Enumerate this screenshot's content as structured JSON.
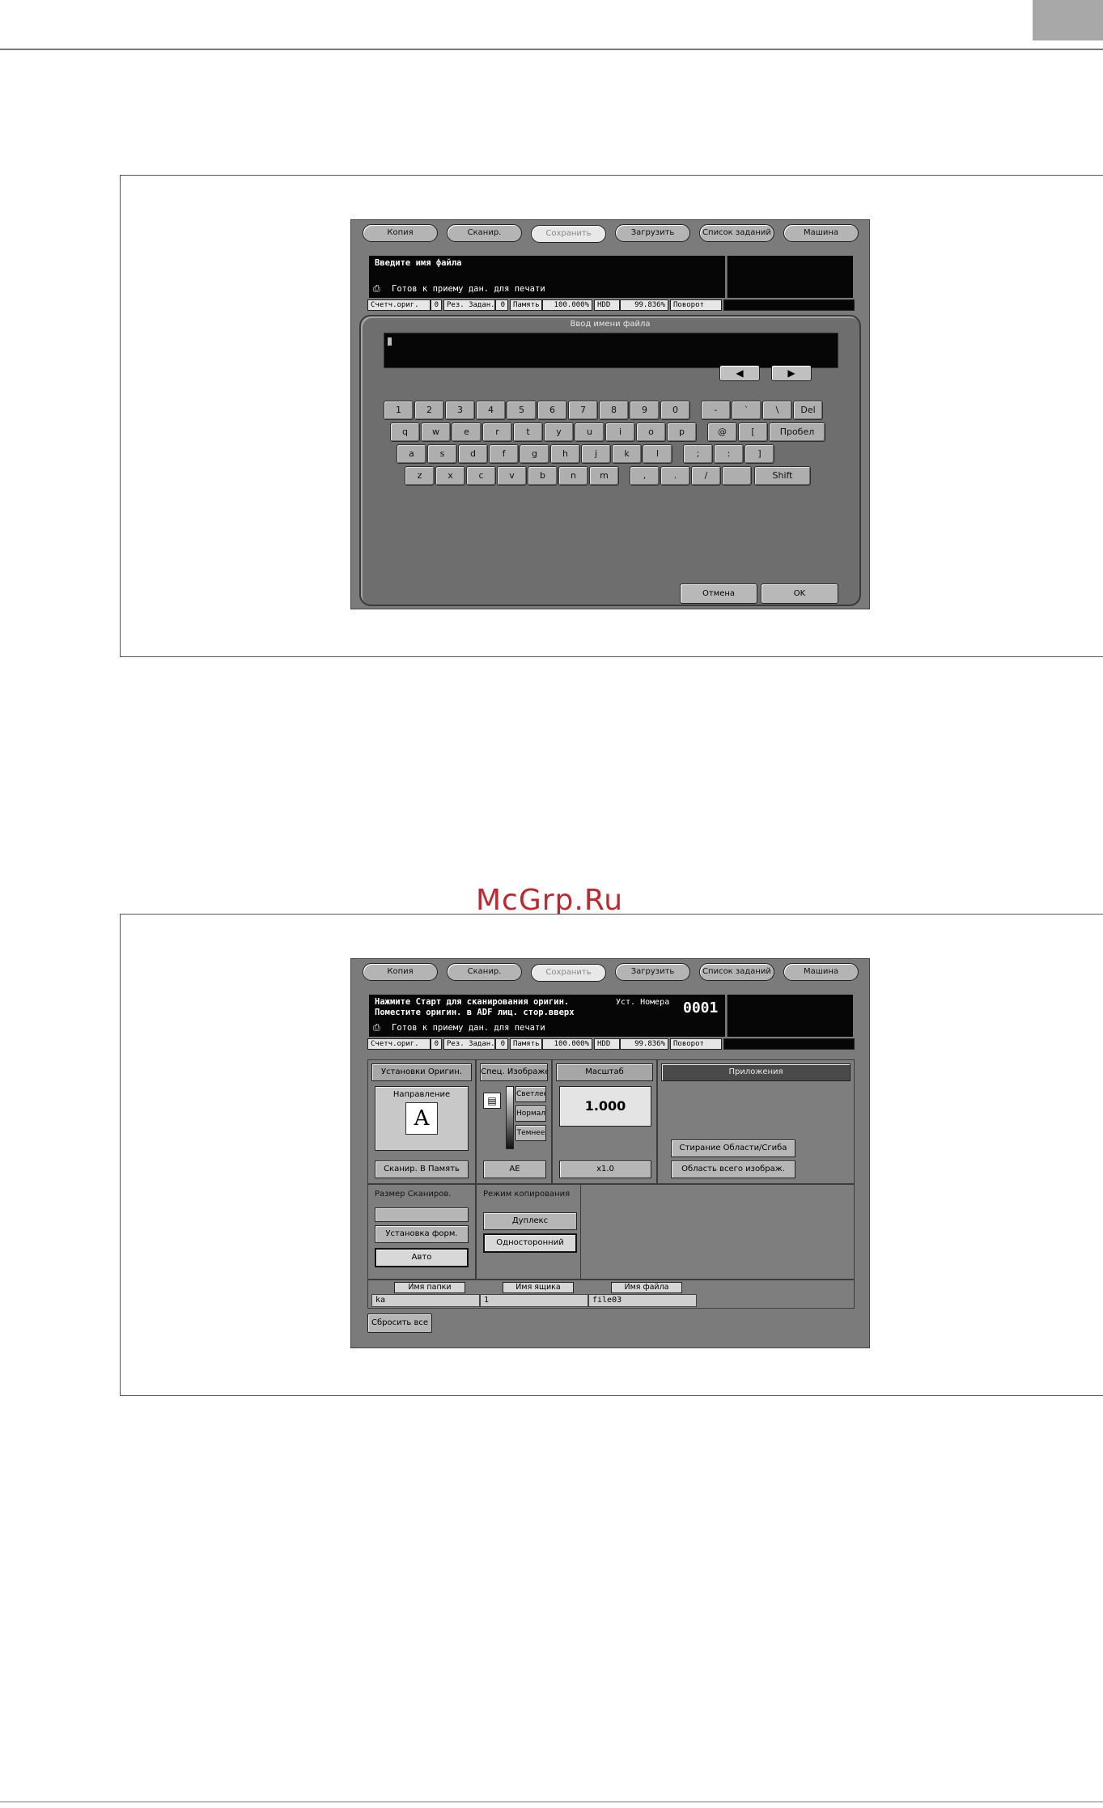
{
  "watermark": "McGrp.Ru",
  "tabs": [
    "Копия",
    "Сканир.",
    "Сохранить",
    "Загрузить",
    "Список заданий",
    "Машина"
  ],
  "counter": {
    "orig_label": "Счетч.ориг.",
    "orig_value": "0",
    "res_label": "Рез. Задан.",
    "res_value": "0",
    "mem_label": "Память",
    "mem_value": "100.000%",
    "hdd_label": "HDD",
    "hdd_value": "99.836%",
    "rotate_label": "Поворот"
  },
  "screen1": {
    "message": "Введите имя файла",
    "status": "Готов к приему дан. для печати",
    "dialog_title": "Ввод имени файла",
    "arrow_left": "◀",
    "arrow_right": "▶",
    "rows": [
      [
        "1",
        "2",
        "3",
        "4",
        "5",
        "6",
        "7",
        "8",
        "9",
        "0",
        "-",
        "`",
        "\\",
        "Del"
      ],
      [
        "q",
        "w",
        "e",
        "r",
        "t",
        "y",
        "u",
        "i",
        "o",
        "p",
        "@",
        "[",
        "Пробел"
      ],
      [
        "a",
        "s",
        "d",
        "f",
        "g",
        "h",
        "j",
        "k",
        "l",
        ";",
        ":",
        "]"
      ],
      [
        "z",
        "x",
        "c",
        "v",
        "b",
        "n",
        "m",
        ",",
        ".",
        "/",
        "",
        "Shift"
      ]
    ],
    "cancel": "Отмена",
    "ok": "OK"
  },
  "screen2": {
    "message_line1": "Нажмите Старт для сканирования оригин.",
    "message_line2": "Поместите оригин. в ADF лиц. стор.вверх",
    "set_number_label": "Уст. Номера",
    "set_number": "0001",
    "status": "Готов к приему дан. для печати",
    "orig_settings": "Установки Оригин.",
    "direction": "Направление",
    "direction_letter": "A",
    "scan_to_memory": "Сканир. В Память",
    "special_image": "Спец. Изображение",
    "lighter": "Светлее",
    "normal": "Нормальн",
    "darker": "Темнее",
    "ae": "AE",
    "scale": "Масштаб",
    "scale_value": "1.000",
    "scale_x": "x1.0",
    "applications": "Приложения",
    "frame_erase": "Стирание Области/Сгиба",
    "full_image": "Область всего изображ.",
    "scan_size": "Размер Сканиров.",
    "form_setting": "Установка форм.",
    "auto": "Авто",
    "copy_mode": "Режим копирования",
    "duplex": "Дуплекс",
    "simplex": "Односторонний",
    "folder_name_label": "Имя папки",
    "box_name_label": "Имя ящика",
    "file_name_label": "Имя файла",
    "folder_name": "ka",
    "box_name": "1",
    "file_name": "file03",
    "reset_all": "Сбросить все"
  }
}
